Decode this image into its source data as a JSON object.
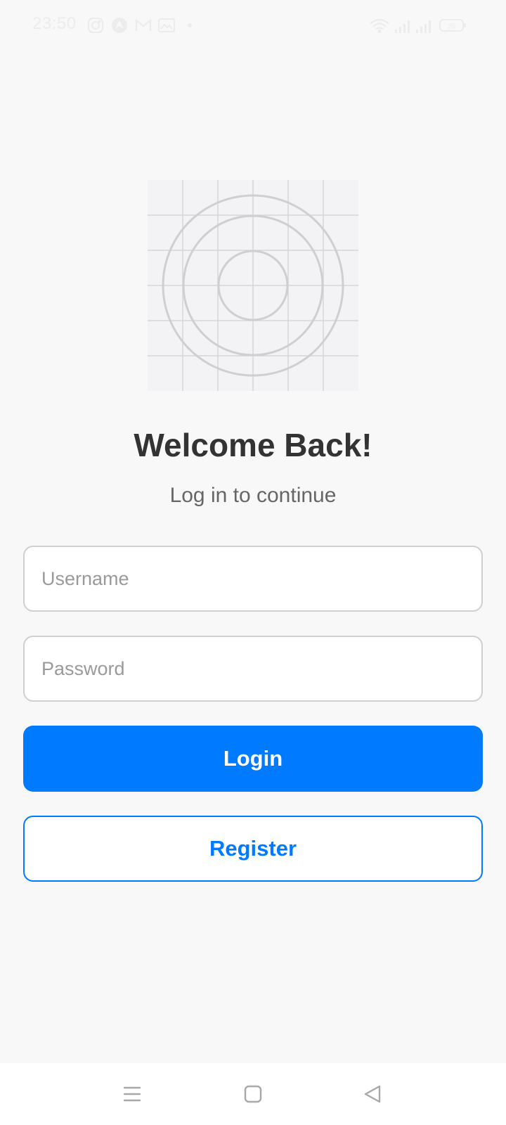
{
  "status_bar": {
    "time": "23:50",
    "left_icons": [
      "instagram-icon",
      "maps-icon",
      "gmail-icon",
      "photo-icon",
      "dot-icon"
    ],
    "right_icons": [
      "wifi-icon",
      "signal-icon",
      "signal-icon",
      "battery-icon"
    ],
    "battery_label": "26"
  },
  "login": {
    "title": "Welcome Back!",
    "subtitle": "Log in to continue",
    "username_placeholder": "Username",
    "password_placeholder": "Password",
    "login_label": "Login",
    "register_label": "Register"
  },
  "nav_bar": {
    "icons": [
      "menu-icon",
      "home-icon",
      "back-icon"
    ]
  },
  "colors": {
    "accent": "#007bff",
    "background": "#f8f8f8",
    "title_text": "#333333",
    "subtitle_text": "#666666"
  }
}
